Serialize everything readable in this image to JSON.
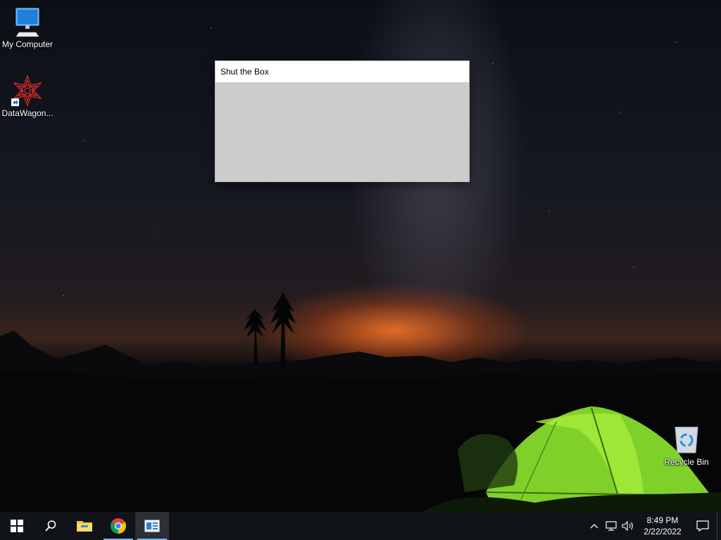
{
  "desktop": {
    "icons": [
      {
        "label": "My Computer",
        "icon": "monitor-icon"
      },
      {
        "label": "DataWagon...",
        "icon": "datawagon-shortcut-icon"
      },
      {
        "label": "Recycle Bin",
        "icon": "recycle-bin-icon"
      }
    ]
  },
  "window": {
    "title": "Shut the Box"
  },
  "taskbar": {
    "buttons": [
      {
        "icon": "windows-start-icon"
      },
      {
        "icon": "search-icon"
      },
      {
        "icon": "file-explorer-icon"
      },
      {
        "icon": "chrome-icon"
      },
      {
        "icon": "app-window-icon"
      }
    ],
    "tray": {
      "icons": [
        "chevron-up-icon",
        "network-icon",
        "volume-icon"
      ],
      "time": "8:49 PM",
      "date": "2/22/2022",
      "notification_icon": "action-center-icon"
    }
  },
  "colors": {
    "accent": "#76b9ed",
    "window_bg": "#cccccc",
    "taskbar_bg": "#101318"
  }
}
